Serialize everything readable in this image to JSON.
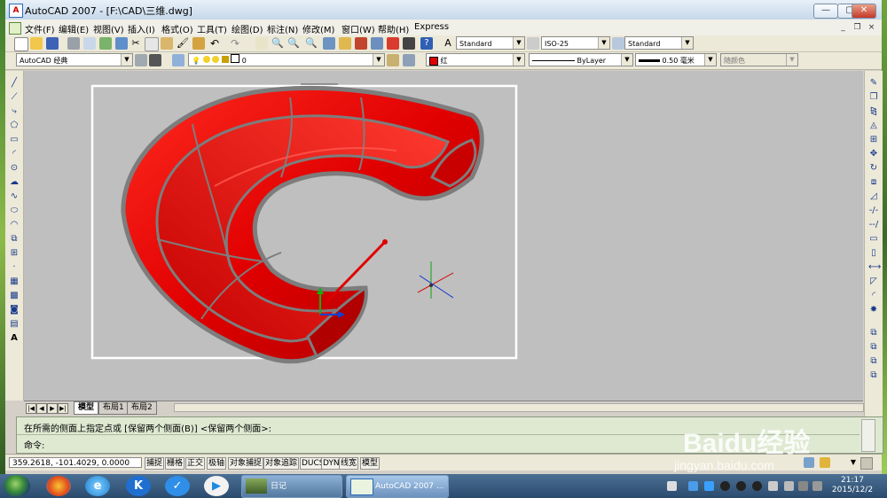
{
  "window": {
    "title": "AutoCAD 2007 - [F:\\CAD\\三维.dwg]",
    "controls": {
      "minimize": "—",
      "maximize": "▢",
      "close": "✕"
    },
    "mdi_controls": {
      "minimize": "_",
      "restore": "❐",
      "close": "×"
    }
  },
  "menu": {
    "items": [
      "文件(F)",
      "编辑(E)",
      "视图(V)",
      "插入(I)",
      "格式(O)",
      "工具(T)",
      "绘图(D)",
      "标注(N)",
      "修改(M)",
      "窗口(W)",
      "帮助(H)",
      "Express"
    ]
  },
  "toolbar_standard": {
    "text_style": "Standard",
    "dim_style": "ISO-25",
    "table_style": "Standard"
  },
  "toolbar_layers": {
    "workspace": "AutoCAD 经典",
    "layer": "0",
    "color": "红",
    "linetype": "ByLayer",
    "lineweight": "0.50 毫米",
    "plot_style": "随颜色"
  },
  "layout_tabs": {
    "tabs": [
      "模型",
      "布局1",
      "布局2"
    ],
    "active": "模型",
    "nav": [
      "|◀",
      "◀",
      "▶",
      "▶|"
    ]
  },
  "command": {
    "history": "在所需的侧面上指定点或 [保留两个侧面(B)] <保留两个侧面>:",
    "prompt": "命令:"
  },
  "status": {
    "coords": "359.2618,  -101.4029,  0.0000",
    "toggles": [
      "捕捉",
      "栅格",
      "正交",
      "极轴",
      "对象捕捉",
      "对象追踪",
      "DUCS",
      "DYN",
      "线宽",
      "模型"
    ]
  },
  "drawing": {
    "object_color": "#e8000a",
    "edge_color": "#7d7d7d",
    "background": "#bfbfbf"
  },
  "taskbar": {
    "tasks": [
      {
        "label": "日记"
      },
      {
        "label": "AutoCAD 2007 ..."
      }
    ],
    "time": "21:17",
    "date": "2015/12/2"
  },
  "watermark": {
    "main": "Baidu经验",
    "sub": "jingyan.baidu.com"
  }
}
